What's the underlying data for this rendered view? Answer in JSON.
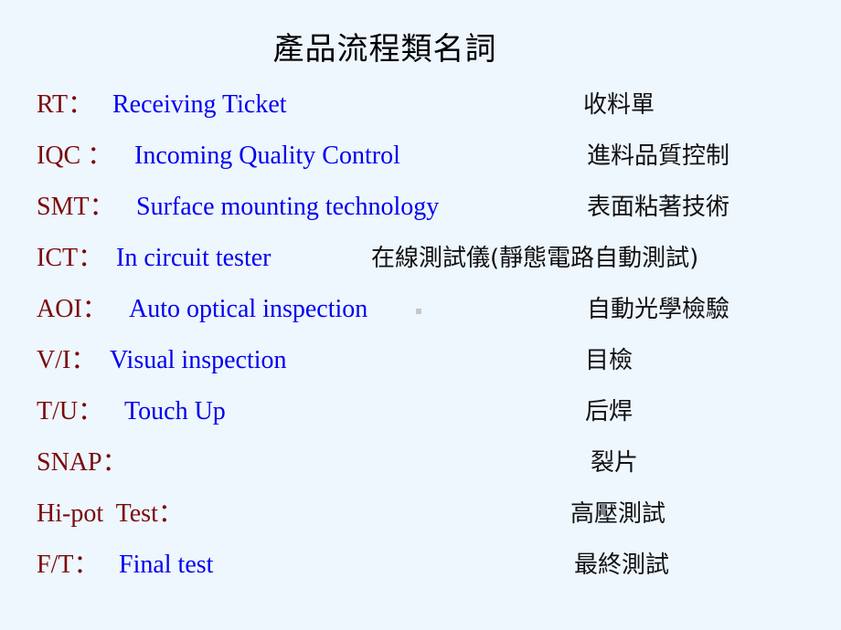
{
  "title": "產品流程類名詞",
  "terms": [
    {
      "abbr": "RT：",
      "english": "Receiving Ticket",
      "chinese": "收料單"
    },
    {
      "abbr": "IQC ：",
      "english": "Incoming Quality Control",
      "chinese": "進料品質控制"
    },
    {
      "abbr": "SMT：",
      "english": "Surface mounting technology",
      "chinese": "表面粘著技術"
    },
    {
      "abbr": "ICT：",
      "english": "In circuit tester",
      "chinese": "在線測試儀(靜態電路自動測試)"
    },
    {
      "abbr": "AOI：",
      "english": "Auto optical inspection",
      "chinese": "自動光學檢驗"
    },
    {
      "abbr": "V/I：",
      "english": "Visual inspection",
      "chinese": "目檢"
    },
    {
      "abbr": "T/U：",
      "english": "Touch Up",
      "chinese": "后焊"
    },
    {
      "abbr": "SNAP：",
      "english": "",
      "chinese": "裂片"
    },
    {
      "abbr": "Hi-pot  Test：",
      "english": "",
      "chinese": "高壓測試"
    },
    {
      "abbr": "F/T：",
      "english": "Final test",
      "chinese": "最終測試"
    }
  ]
}
